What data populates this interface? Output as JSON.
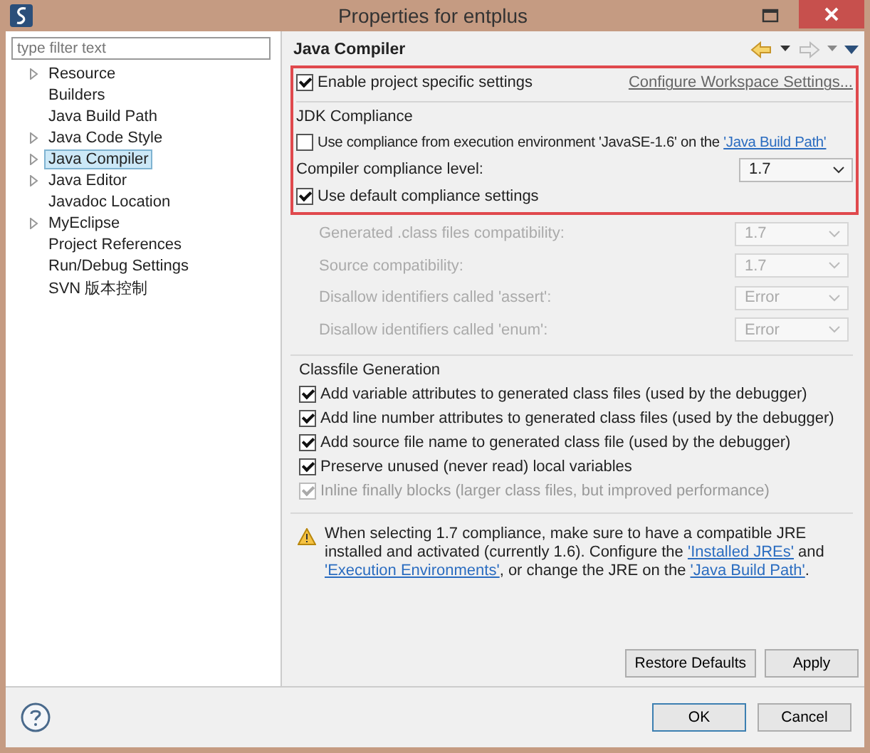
{
  "window": {
    "title": "Properties for entplus"
  },
  "filter": {
    "placeholder": "type filter text"
  },
  "tree": [
    {
      "label": "Resource",
      "expandable": true,
      "selected": false
    },
    {
      "label": "Builders",
      "expandable": false,
      "selected": false
    },
    {
      "label": "Java Build Path",
      "expandable": false,
      "selected": false
    },
    {
      "label": "Java Code Style",
      "expandable": true,
      "selected": false
    },
    {
      "label": "Java Compiler",
      "expandable": true,
      "selected": true
    },
    {
      "label": "Java Editor",
      "expandable": true,
      "selected": false
    },
    {
      "label": "Javadoc Location",
      "expandable": false,
      "selected": false
    },
    {
      "label": "MyEclipse",
      "expandable": true,
      "selected": false
    },
    {
      "label": "Project References",
      "expandable": false,
      "selected": false
    },
    {
      "label": "Run/Debug Settings",
      "expandable": false,
      "selected": false
    },
    {
      "label": "SVN 版本控制",
      "expandable": false,
      "selected": false
    }
  ],
  "page": {
    "title": "Java Compiler"
  },
  "enable_project_settings": {
    "label": "Enable project specific settings",
    "checked": true
  },
  "configure_link": "Configure Workspace Settings...",
  "jdk_compliance": {
    "title": "JDK Compliance",
    "use_ee": {
      "label": "Use compliance from execution environment 'JavaSE-1.6' on the",
      "link": "'Java Build Path'",
      "checked": false
    },
    "level": {
      "label": "Compiler compliance level:",
      "value": "1.7"
    },
    "use_default": {
      "label": "Use default compliance settings",
      "checked": true
    },
    "settings": [
      {
        "label": "Generated .class files compatibility:",
        "value": "1.7",
        "disabled": true
      },
      {
        "label": "Source compatibility:",
        "value": "1.7",
        "disabled": true
      },
      {
        "label": "Disallow identifiers called 'assert':",
        "value": "Error",
        "disabled": true
      },
      {
        "label": "Disallow identifiers called 'enum':",
        "value": "Error",
        "disabled": true
      }
    ]
  },
  "classfile": {
    "title": "Classfile Generation",
    "options": [
      {
        "label": "Add variable attributes to generated class files (used by the debugger)",
        "checked": true,
        "disabled": false
      },
      {
        "label": "Add line number attributes to generated class files (used by the debugger)",
        "checked": true,
        "disabled": false
      },
      {
        "label": "Add source file name to generated class file (used by the debugger)",
        "checked": true,
        "disabled": false
      },
      {
        "label": "Preserve unused (never read) local variables",
        "checked": true,
        "disabled": false
      },
      {
        "label": "Inline finally blocks (larger class files, but improved performance)",
        "checked": true,
        "disabled": true
      }
    ]
  },
  "warning": [
    {
      "kind": "text",
      "text": "When selecting 1.7 compliance, make sure to have a compatible JRE installed and activated (currently 1.6). Configure the "
    },
    {
      "kind": "link",
      "text": "'Installed JREs'"
    },
    {
      "kind": "text",
      "text": " and "
    },
    {
      "kind": "link",
      "text": "'Execution Environments'"
    },
    {
      "kind": "text",
      "text": ", or change the JRE on the "
    },
    {
      "kind": "link",
      "text": "'Java Build Path'"
    },
    {
      "kind": "text",
      "text": "."
    }
  ],
  "buttons": [
    "Restore Defaults",
    "Apply"
  ],
  "dialog_buttons": [
    "OK",
    "Cancel"
  ]
}
